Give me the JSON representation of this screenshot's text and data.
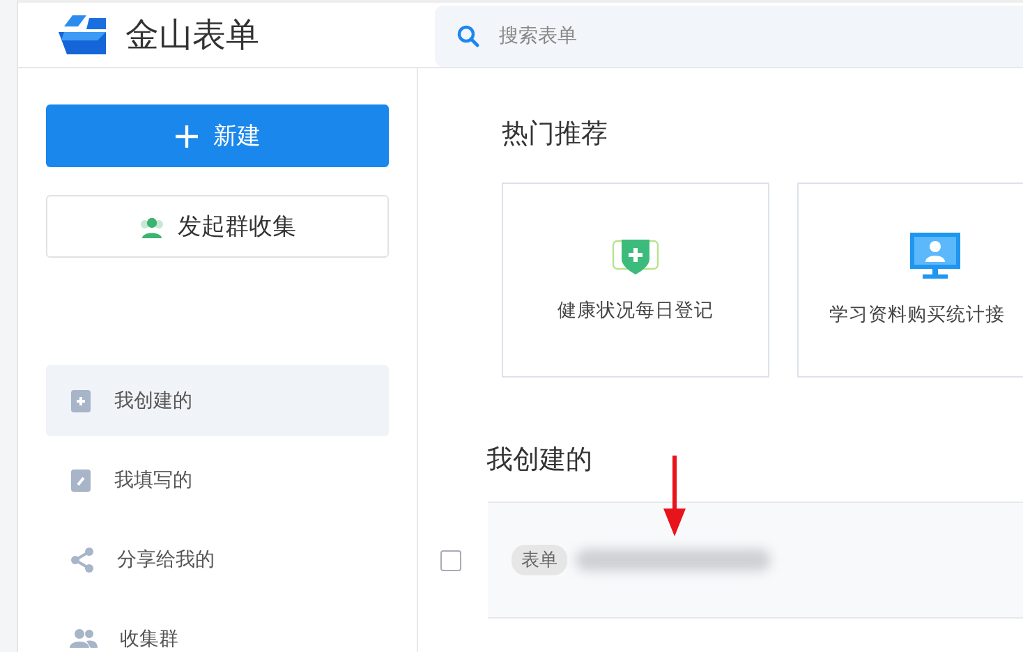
{
  "header": {
    "app_name": "金山表单",
    "search": {
      "placeholder": "搜索表单"
    }
  },
  "sidebar": {
    "new_button": "新建",
    "group_button": "发起群收集",
    "items": [
      {
        "label": "我创建的",
        "kind": "created",
        "selected": true
      },
      {
        "label": "我填写的",
        "kind": "filled",
        "selected": false
      },
      {
        "label": "分享给我的",
        "kind": "shared",
        "selected": false
      },
      {
        "label": "收集群",
        "kind": "group",
        "selected": false
      }
    ]
  },
  "recommend": {
    "title": "热门推荐",
    "cards": [
      {
        "label": "健康状况每日登记",
        "kind": "health"
      },
      {
        "label": "学习资料购买统计接",
        "kind": "study"
      }
    ]
  },
  "mine": {
    "title": "我创建的",
    "rows": [
      {
        "tag": "表单",
        "checked": false
      }
    ]
  }
}
